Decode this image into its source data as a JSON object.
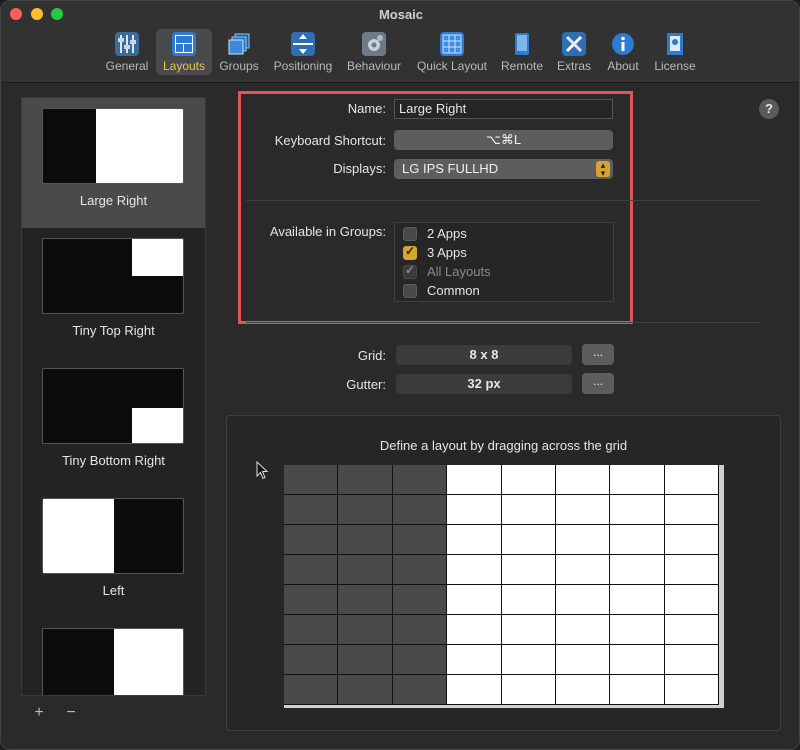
{
  "window": {
    "title": "Mosaic"
  },
  "toolbar": {
    "items": [
      {
        "label": "General",
        "icon": "sliders-icon",
        "active": false
      },
      {
        "label": "Layouts",
        "icon": "layouts-icon",
        "active": true
      },
      {
        "label": "Groups",
        "icon": "groups-icon",
        "active": false
      },
      {
        "label": "Positioning",
        "icon": "positioning-icon",
        "active": false
      },
      {
        "label": "Behaviour",
        "icon": "gear-icon",
        "active": false
      },
      {
        "label": "Quick Layout",
        "icon": "quick-layout-icon",
        "active": false
      },
      {
        "label": "Remote",
        "icon": "remote-icon",
        "active": false
      },
      {
        "label": "Extras",
        "icon": "tools-icon",
        "active": false
      },
      {
        "label": "About",
        "icon": "info-icon",
        "active": false
      },
      {
        "label": "License",
        "icon": "license-icon",
        "active": false
      }
    ]
  },
  "sidebar": {
    "items": [
      {
        "label": "Large Right",
        "selected": true
      },
      {
        "label": "Tiny Top Right",
        "selected": false
      },
      {
        "label": "Tiny Bottom Right",
        "selected": false
      },
      {
        "label": "Left",
        "selected": false
      },
      {
        "label": "",
        "selected": false
      }
    ],
    "add_label": "+",
    "remove_label": "−"
  },
  "form": {
    "name_label": "Name:",
    "name_value": "Large Right",
    "shortcut_label": "Keyboard Shortcut:",
    "shortcut_value": "⌥⌘L",
    "displays_label": "Displays:",
    "displays_value": "LG IPS FULLHD",
    "groups_label": "Available in Groups:",
    "groups": [
      {
        "label": "2 Apps",
        "checked": false,
        "disabled": false
      },
      {
        "label": "3 Apps",
        "checked": true,
        "disabled": false
      },
      {
        "label": "All Layouts",
        "checked": true,
        "disabled": true
      },
      {
        "label": "Common",
        "checked": false,
        "disabled": false
      }
    ],
    "grid_label": "Grid:",
    "grid_value": "8 x 8",
    "gutter_label": "Gutter:",
    "gutter_value": "32 px",
    "more_label": "...",
    "help_label": "?"
  },
  "grid_panel": {
    "title": "Define a layout by dragging across the grid",
    "columns": 8,
    "rows": 8,
    "selected_columns": [
      3,
      4,
      5,
      6,
      7
    ]
  },
  "colors": {
    "accent": "#d7a52e",
    "highlight_border": "#e05654",
    "active_tab_label": "#e9c44a"
  }
}
